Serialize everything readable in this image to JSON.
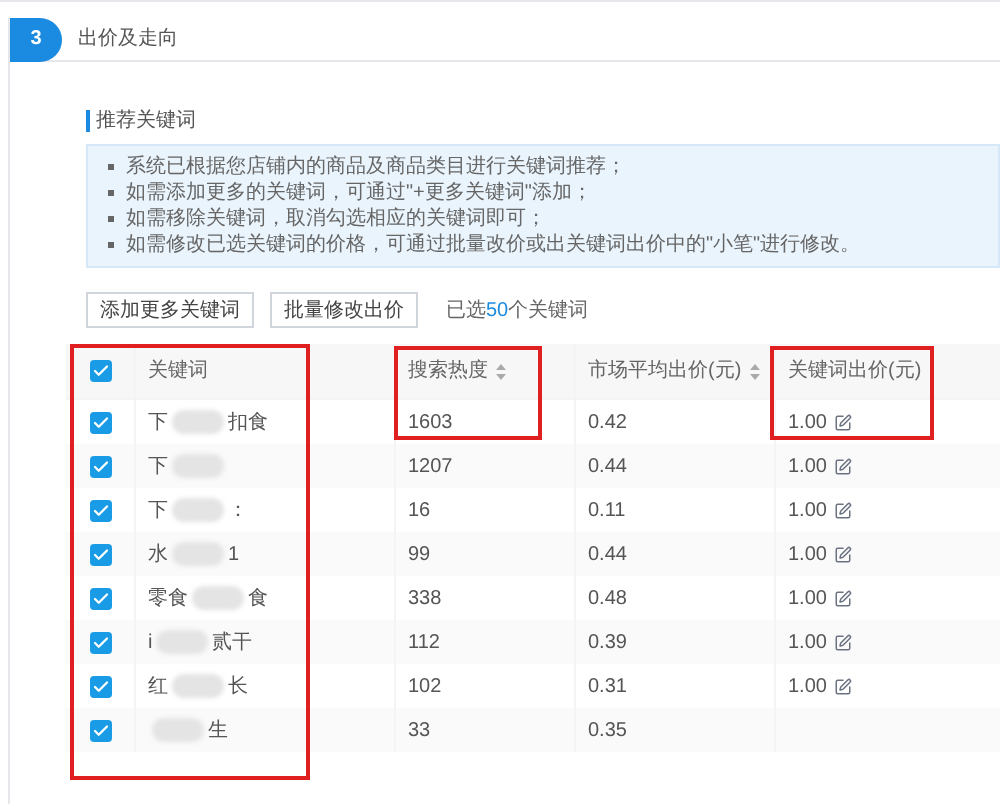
{
  "step": {
    "number": "3",
    "title": "出价及走向"
  },
  "section_title": "推荐关键词",
  "notes": [
    "系统已根据您店铺内的商品及商品类目进行关键词推荐；",
    "如需添加更多的关键词，可通过\"+更多关键词\"添加；",
    "如需移除关键词，取消勾选相应的关键词即可；",
    "如需修改已选关键词的价格，可通过批量改价或出关键词出价中的\"小笔\"进行修改。"
  ],
  "buttons": [
    "添加更多关键词",
    "批量修改出价"
  ],
  "selection": {
    "before": "已选",
    "count": "50",
    "after": "个关键词"
  },
  "table": {
    "all_checked": true,
    "columns": [
      {
        "label": "关键词",
        "sortable": false,
        "highlighted": true,
        "highlight_full_height": true
      },
      {
        "label": "搜索热度",
        "sortable": true,
        "highlighted": true,
        "highlight_full_height": false
      },
      {
        "label": "市场平均出价(元)",
        "sortable": true,
        "highlighted": false
      },
      {
        "label": "关键词出价(元)",
        "sortable": false,
        "highlighted": true,
        "highlight_full_height": false
      }
    ],
    "rows": [
      {
        "checked": true,
        "keyword_start": "下",
        "keyword_end": "扣食",
        "heat": "1603",
        "market": "0.42",
        "bid": "1.00"
      },
      {
        "checked": true,
        "keyword_start": "下",
        "heat": "1207",
        "market": "0.44",
        "bid": "1.00"
      },
      {
        "checked": true,
        "keyword_start": "下",
        "keyword_end": "：",
        "heat": "16",
        "market": "0.11",
        "bid": "1.00"
      },
      {
        "checked": true,
        "keyword_start": "水",
        "keyword_end": "1",
        "heat": "99",
        "market": "0.44",
        "bid": "1.00"
      },
      {
        "checked": true,
        "keyword_start": "零食",
        "keyword_end": "食",
        "heat": "338",
        "market": "0.48",
        "bid": "1.00"
      },
      {
        "checked": true,
        "keyword_start": "i",
        "keyword_end": "贰干",
        "heat": "112",
        "market": "0.39",
        "bid": "1.00"
      },
      {
        "checked": true,
        "keyword_start": "红",
        "keyword_end": "长",
        "heat": "102",
        "market": "0.31",
        "bid": "1.00"
      },
      {
        "checked": true,
        "keyword_end": "生",
        "heat": "33",
        "market": "0.35"
      }
    ]
  }
}
